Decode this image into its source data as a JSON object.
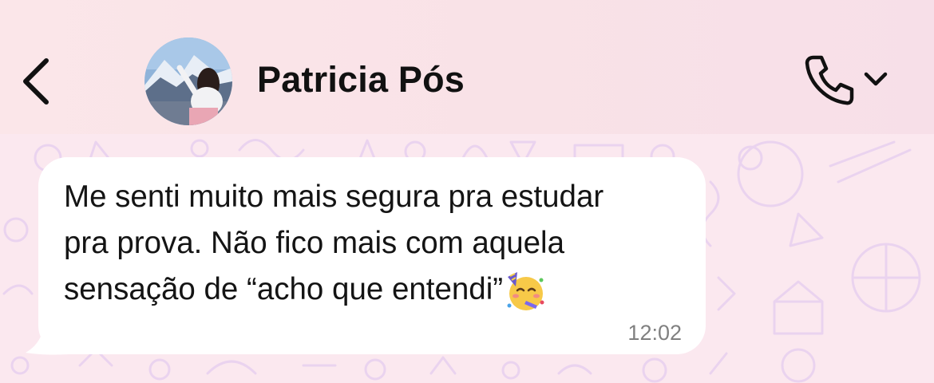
{
  "header": {
    "contact_name": "Patricia Pós",
    "icons": [
      "back-icon",
      "avatar",
      "call-icon",
      "chevron-down-icon"
    ]
  },
  "message": {
    "text": "Me senti muito mais segura pra estudar\npra prova. Não fico mais com aquela\nsensação de “acho que entendi”",
    "emoji": "partying-face",
    "time": "12:02"
  },
  "colors": {
    "header_bg": "#fae3e8",
    "chat_bg": "#fbe8ef",
    "pattern": "#e9d4f0",
    "bubble": "#ffffff",
    "text": "#141414",
    "timestamp": "#808080"
  }
}
